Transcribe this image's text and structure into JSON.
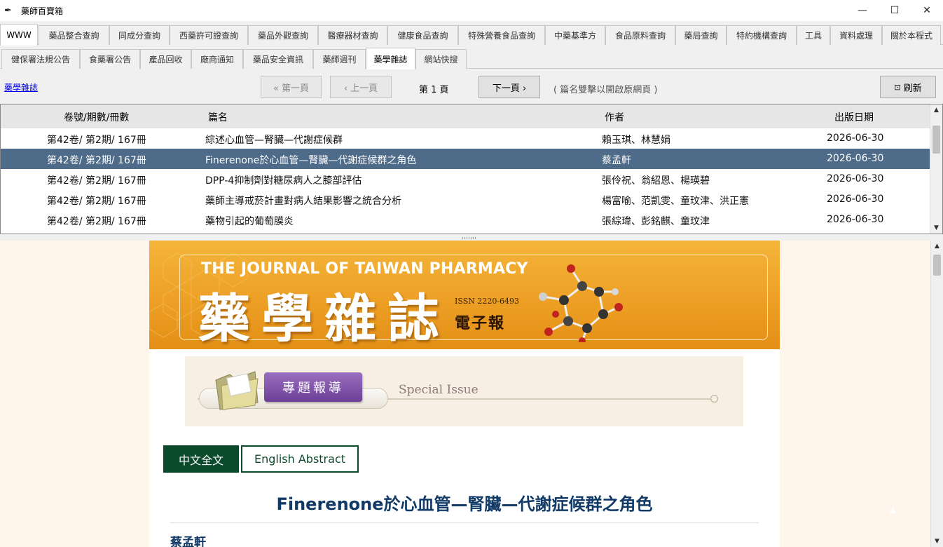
{
  "window": {
    "title": "藥師百寶箱",
    "controls": {
      "minimize": "—",
      "maximize": "☐",
      "close": "✕"
    }
  },
  "main_tabs": [
    {
      "label": "WWW",
      "active": true
    },
    {
      "label": "藥品整合查詢"
    },
    {
      "label": "同成分查詢"
    },
    {
      "label": "西藥許可證查詢"
    },
    {
      "label": "藥品外觀查詢"
    },
    {
      "label": "醫療器材查詢"
    },
    {
      "label": "健康食品查詢"
    },
    {
      "label": "特殊營養食品查詢"
    },
    {
      "label": "中藥基準方"
    },
    {
      "label": "食品原料查詢"
    },
    {
      "label": "藥局查詢"
    },
    {
      "label": "特約機構查詢"
    },
    {
      "label": "工具"
    },
    {
      "label": "資料處理"
    },
    {
      "label": "關於本程式"
    }
  ],
  "sub_tabs": [
    {
      "label": "健保署法規公告"
    },
    {
      "label": "食藥署公告"
    },
    {
      "label": "產品回收"
    },
    {
      "label": "廠商通知"
    },
    {
      "label": "藥品安全資訊"
    },
    {
      "label": "藥師週刊"
    },
    {
      "label": "藥學雜誌",
      "active": true
    },
    {
      "label": "網站快搜"
    }
  ],
  "toolbar": {
    "link": "藥學雜誌",
    "first_page": "« 第一頁",
    "prev_page": "‹ 上一頁",
    "page_label": "第 1 頁",
    "next_page": "下一頁 ›",
    "hint": "( 篇名雙擊以開啟原網頁 )",
    "refresh": "刷新",
    "refresh_icon": "⊡"
  },
  "table": {
    "headers": [
      "卷號/期數/冊數",
      "篇名",
      "作者",
      "出版日期"
    ],
    "rows": [
      {
        "vol": "第42卷/ 第2期/ 167冊",
        "title": "綜述心血管—腎臟—代謝症候群",
        "author": "賴玉琪、林慧娟",
        "date": "2026-06-30"
      },
      {
        "vol": "第42卷/ 第2期/ 167冊",
        "title": "Finerenone於心血管—腎臟—代謝症候群之角色",
        "author": "蔡孟軒",
        "date": "2026-06-30",
        "selected": true
      },
      {
        "vol": "第42卷/ 第2期/ 167冊",
        "title": "DPP-4抑制劑對糖尿病人之膝部評估",
        "author": "張伶祝、翁紹恩、楊瑛碧",
        "date": "2026-06-30"
      },
      {
        "vol": "第42卷/ 第2期/ 167冊",
        "title": "藥師主導戒菸計畫對病人結果影響之統合分析",
        "author": "楊富喻、范凱雯、童玟津、洪正憲",
        "date": "2026-06-30"
      },
      {
        "vol": "第42卷/ 第2期/ 167冊",
        "title": "藥物引起的葡萄膜炎",
        "author": "張綜瑋、彭銘麒、童玟津",
        "date": "2026-06-30"
      }
    ],
    "selected_color": "#4f6b8a"
  },
  "web": {
    "banner_en": "THE JOURNAL OF TAIWAN PHARMACY",
    "banner_zh": "藥學雜誌",
    "issn": "ISSN 2220-6493",
    "ebao": "電子報",
    "special_zh": "專題報導",
    "special_en": "Special Issue",
    "tab_zh": "中文全文",
    "tab_en": "English Abstract",
    "article_title": "Finerenone於心血管—腎臟—代謝症候群之角色",
    "article_author": "蔡孟軒",
    "accent_green": "#0c4a2c",
    "title_blue": "#123a66"
  }
}
